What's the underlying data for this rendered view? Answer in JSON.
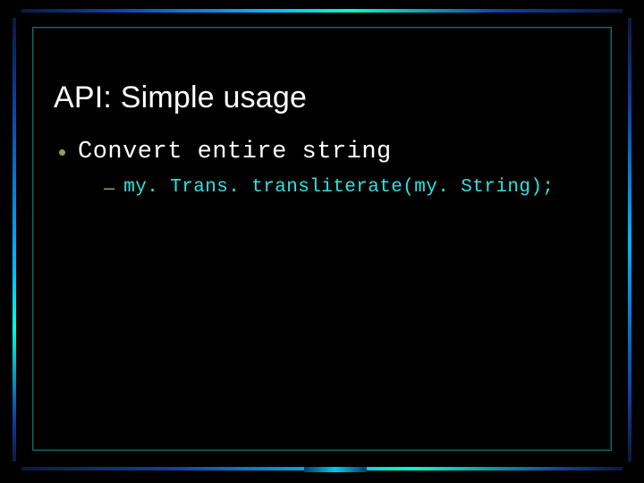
{
  "slide": {
    "title": "API: Simple usage",
    "bullet1": "Convert entire string",
    "sub1": "my. Trans. transliterate(my. String);"
  }
}
